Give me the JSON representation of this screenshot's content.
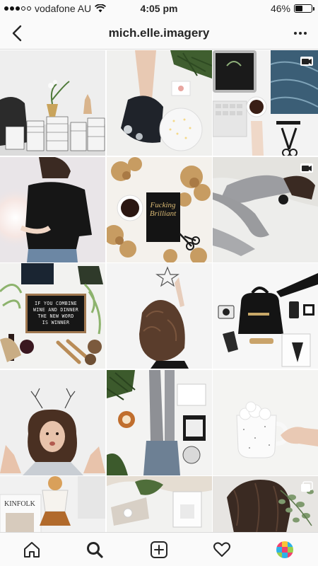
{
  "status_bar": {
    "carrier": "vodafone AU",
    "time": "4:05 pm",
    "battery": "46%",
    "battery_level": 0.46
  },
  "header": {
    "username": "mich.elle.imagery"
  },
  "grid": {
    "letterboard_lines": [
      "IF YOU COMBINE",
      "WINE AND DINNER",
      "THE NEW WORD",
      "IS WINNER"
    ],
    "book_title": [
      "Fucking",
      "Brilliant"
    ]
  },
  "tabs": [
    "home",
    "search",
    "new-post",
    "activity",
    "profile"
  ]
}
